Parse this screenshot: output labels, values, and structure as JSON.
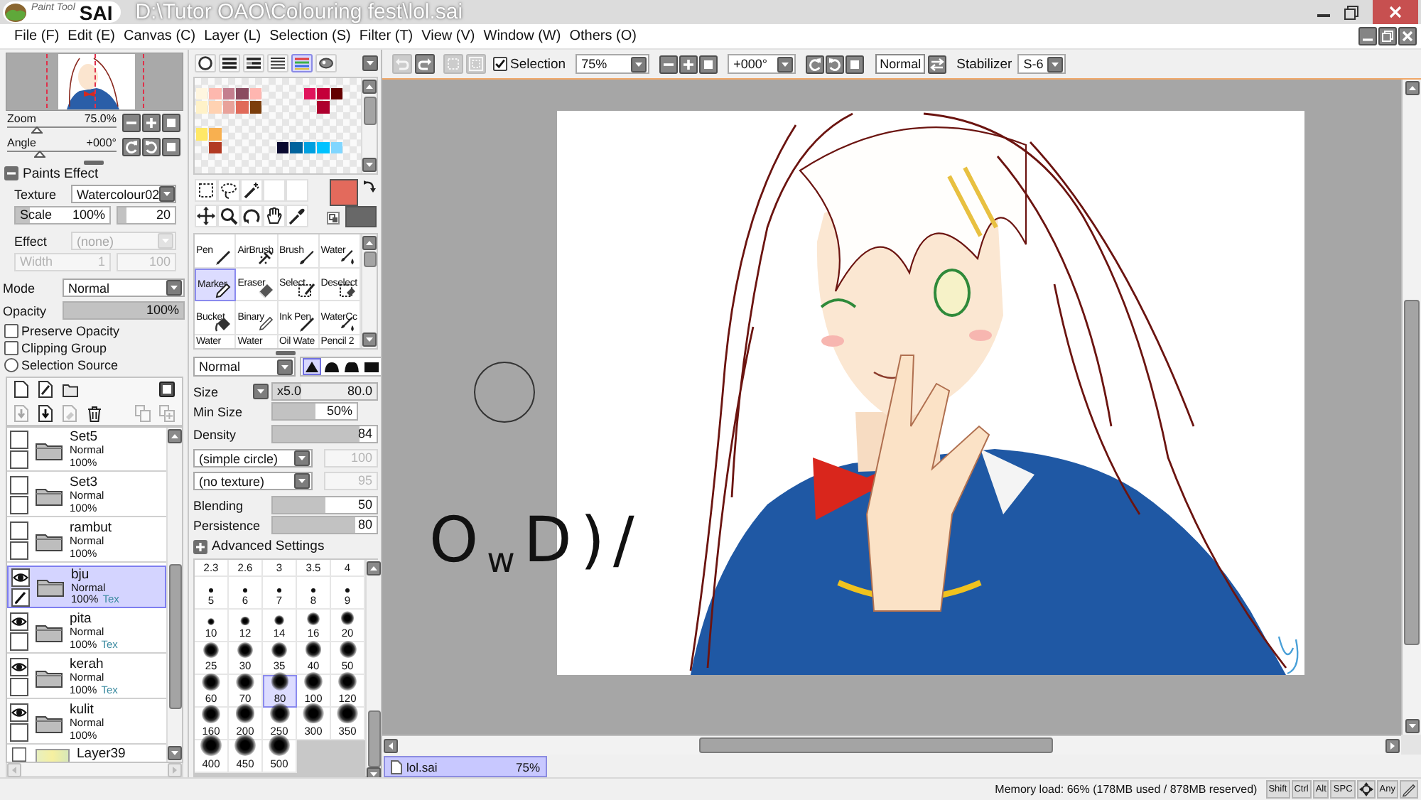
{
  "title_bar": {
    "logo": {
      "subtitle": "Paint Tool",
      "title": "SAI"
    },
    "title": "D:\\Tutor OAO\\Colouring fest\\lol.sai"
  },
  "menu": [
    "File (F)",
    "Edit (E)",
    "Canvas (C)",
    "Layer (L)",
    "Selection (S)",
    "Filter (T)",
    "View (V)",
    "Window (W)",
    "Others (O)"
  ],
  "navigator": {
    "zoom": {
      "label": "Zoom",
      "reading": "75.0%",
      "level": 0.27
    },
    "angle": {
      "label": "Angle",
      "reading": "+000°",
      "level": 0.3
    }
  },
  "paints_effect": {
    "title": "Paints Effect",
    "expanded": true,
    "texture": {
      "label": "Texture",
      "value": "Watercolour02"
    },
    "scale": {
      "label": "Scale",
      "reading": "100%",
      "level": 0.15,
      "disabled": false
    },
    "strength": {
      "reading": "20",
      "level": 0.15,
      "disabled": false
    },
    "effect": {
      "label": "Effect",
      "value": "(none)",
      "disabled": true
    },
    "width": {
      "label": "Width",
      "reading": "1",
      "disabled": true
    },
    "width_strength": {
      "reading": "100",
      "disabled": true
    }
  },
  "layer_settings": {
    "mode": {
      "label": "Mode",
      "value": "Normal"
    },
    "opacity": {
      "label": "Opacity",
      "reading": "100%",
      "level": 1
    },
    "options": [
      {
        "kind": "checkbox",
        "label": "Preserve Opacity",
        "checked": false
      },
      {
        "kind": "checkbox",
        "label": "Clipping Group",
        "checked": false
      },
      {
        "kind": "radio",
        "label": "Selection Source",
        "checked": false
      }
    ]
  },
  "layer_tools": [
    {
      "left": [
        {
          "kind": "new_layer",
          "disabled": false
        },
        {
          "kind": "new_linework",
          "disabled": false
        },
        {
          "kind": "new_folder",
          "disabled": false
        }
      ],
      "right": [
        {
          "kind": "mask",
          "disabled": false
        }
      ]
    },
    {
      "left": [
        {
          "kind": "transfer_down",
          "disabled": true
        },
        {
          "kind": "merge_down",
          "disabled": false
        },
        {
          "kind": "clear",
          "disabled": true
        },
        {
          "kind": "delete",
          "disabled": false
        }
      ],
      "right": [
        {
          "kind": "merge_visible",
          "disabled": true
        },
        {
          "kind": "merge_new",
          "disabled": true
        }
      ]
    }
  ],
  "layers": [
    {
      "kind": "folder",
      "name": "Set5",
      "mode": "Normal",
      "opacity": "100%",
      "visible": false,
      "selected": false
    },
    {
      "kind": "folder",
      "name": "Set3",
      "mode": "Normal",
      "opacity": "100%",
      "visible": false,
      "selected": false
    },
    {
      "kind": "folder",
      "name": "rambut",
      "mode": "Normal",
      "opacity": "100%",
      "visible": false,
      "selected": false
    },
    {
      "kind": "folder",
      "name": "bju",
      "mode": "Normal",
      "opacity": "100%",
      "tag": "Tex",
      "visible": true,
      "selected": true
    },
    {
      "kind": "folder",
      "name": "pita",
      "mode": "Normal",
      "opacity": "100%",
      "tag": "Tex",
      "visible": true,
      "selected": false
    },
    {
      "kind": "folder",
      "name": "kerah",
      "mode": "Normal",
      "opacity": "100%",
      "tag": "Tex",
      "visible": true,
      "selected": false
    },
    {
      "kind": "folder",
      "name": "kulit",
      "mode": "Normal",
      "opacity": "100%",
      "visible": true,
      "selected": false
    },
    {
      "kind": "layer",
      "name": "Layer39",
      "visible": false,
      "selected": false
    }
  ],
  "color_modes": [
    {
      "kind": "wheel",
      "selected": false
    },
    {
      "kind": "rgb",
      "selected": false
    },
    {
      "kind": "hsv",
      "selected": false
    },
    {
      "kind": "hsl",
      "selected": false
    },
    {
      "kind": "swatches",
      "selected": true
    },
    {
      "kind": "scratchpad",
      "selected": false
    }
  ],
  "swatch_rows": [
    [
      {
        "color": "#fff6e0"
      },
      {
        "color": "#fdb8ae"
      },
      {
        "color": "#c47e8e"
      },
      {
        "color": "#8a4b60"
      },
      {
        "color": "#ffb6b0"
      },
      null,
      null,
      null,
      {
        "color": "#e0145c"
      },
      {
        "color": "#c4003a"
      },
      {
        "color": "#640000"
      },
      null
    ],
    [
      {
        "color": "#fff2c8"
      },
      {
        "color": "#ffd2b2"
      },
      {
        "color": "#e8a29a"
      },
      {
        "color": "#e06a5a"
      },
      {
        "color": "#7c3e0c"
      },
      null,
      null,
      null,
      null,
      {
        "color": "#ae002e"
      },
      null,
      null
    ],
    [
      null,
      null,
      null,
      null,
      null,
      null,
      null,
      null,
      null,
      null,
      null,
      null
    ],
    [
      {
        "color": "#ffe866"
      },
      {
        "color": "#f8b050"
      },
      null,
      null,
      null,
      null,
      null,
      null,
      null,
      null,
      null,
      null
    ],
    [
      null,
      {
        "color": "#b23a22"
      },
      null,
      null,
      null,
      null,
      {
        "color": "#0a0a30"
      },
      {
        "color": "#00629c"
      },
      {
        "color": "#00a0e0"
      },
      {
        "color": "#00c2ff"
      },
      {
        "color": "#80d6ff"
      },
      null
    ]
  ],
  "colors": {
    "primary": {
      "color": "#e36a5c"
    },
    "secondary": {
      "color": "#686868"
    }
  },
  "brush_tools": [
    {
      "label": "Pen",
      "kind": "pen",
      "selected": false
    },
    {
      "label": "AirBrush",
      "kind": "airbrush",
      "selected": false
    },
    {
      "label": "Brush",
      "kind": "brush",
      "selected": false
    },
    {
      "label": "Water",
      "kind": "water",
      "selected": false
    },
    {
      "label": "Marker",
      "kind": "marker",
      "selected": true
    },
    {
      "label": "Eraser",
      "kind": "eraser",
      "selected": false
    },
    {
      "label": "Select",
      "kind": "select",
      "selected": false
    },
    {
      "label": "Deselect",
      "kind": "deselect",
      "selected": false
    },
    {
      "label": "Bucket",
      "kind": "bucket",
      "selected": false
    },
    {
      "label": "Binary",
      "kind": "binary",
      "selected": false
    },
    {
      "label": "Ink Pen",
      "kind": "pen",
      "selected": false
    },
    {
      "label": "WaterCc",
      "kind": "water",
      "selected": false
    },
    {
      "label": "Water",
      "kind": "none",
      "selected": false
    },
    {
      "label": "Water",
      "kind": "none",
      "selected": false
    },
    {
      "label": "Oil Wate",
      "kind": "none",
      "selected": false
    },
    {
      "label": "Pencil 2",
      "kind": "none",
      "selected": false
    }
  ],
  "brush_mode": {
    "value": "Normal"
  },
  "brush_shapes": [
    {
      "kind": "sharp",
      "selected": true
    },
    {
      "kind": "soft",
      "selected": false
    },
    {
      "kind": "flat",
      "selected": false
    },
    {
      "kind": "square",
      "selected": false
    }
  ],
  "brush_settings": {
    "size": {
      "label": "Size",
      "multiplier": "x5.0",
      "reading": "80.0",
      "level": 0.27
    },
    "min_size": {
      "label": "Min Size",
      "reading": "50%",
      "level": 0.5
    },
    "density": {
      "label": "Density",
      "reading": "84",
      "level": 0.84
    },
    "shape": {
      "value": "(simple circle)",
      "strength": {
        "reading": "100",
        "disabled": true
      }
    },
    "texture": {
      "value": "(no texture)",
      "strength": {
        "reading": "95",
        "disabled": true
      }
    },
    "blending": {
      "label": "Blending",
      "reading": "50",
      "level": 0.5
    },
    "persistence": {
      "label": "Persistence",
      "reading": "80",
      "level": 0.8
    },
    "advanced": {
      "label": "Advanced Settings",
      "expanded": false
    }
  },
  "brush_sizes": [
    {
      "label": "2.3",
      "selected": false
    },
    {
      "label": "2.6",
      "selected": false
    },
    {
      "label": "3",
      "selected": false
    },
    {
      "label": "3.5",
      "selected": false
    },
    {
      "label": "4",
      "selected": false
    },
    {
      "label": "5",
      "selected": false
    },
    {
      "label": "6",
      "selected": false
    },
    {
      "label": "7",
      "selected": false
    },
    {
      "label": "8",
      "selected": false
    },
    {
      "label": "9",
      "selected": false
    },
    {
      "label": "10",
      "selected": false
    },
    {
      "label": "12",
      "selected": false
    },
    {
      "label": "14",
      "selected": false
    },
    {
      "label": "16",
      "selected": false
    },
    {
      "label": "20",
      "selected": false
    },
    {
      "label": "25",
      "selected": false
    },
    {
      "label": "30",
      "selected": false
    },
    {
      "label": "35",
      "selected": false
    },
    {
      "label": "40",
      "selected": false
    },
    {
      "label": "50",
      "selected": false
    },
    {
      "label": "60",
      "selected": false
    },
    {
      "label": "70",
      "selected": false
    },
    {
      "label": "80",
      "selected": true
    },
    {
      "label": "100",
      "selected": false
    },
    {
      "label": "120",
      "selected": false
    },
    {
      "label": "160",
      "selected": false
    },
    {
      "label": "200",
      "selected": false
    },
    {
      "label": "250",
      "selected": false
    },
    {
      "label": "300",
      "selected": false
    },
    {
      "label": "350",
      "selected": false
    },
    {
      "label": "400",
      "selected": false
    },
    {
      "label": "450",
      "selected": false
    },
    {
      "label": "500",
      "selected": false
    }
  ],
  "canvas_toolbar": {
    "edit_buttons": [
      {
        "kind": "undo",
        "disabled": true
      },
      {
        "kind": "redo",
        "disabled": false
      },
      {
        "kind": "deselect",
        "disabled": true
      },
      {
        "kind": "invert",
        "disabled": true
      }
    ],
    "selection": {
      "label": "Selection",
      "checked": true
    },
    "zoom": "75%",
    "angle": "+000°",
    "view_mode": "Normal",
    "stabilizer": {
      "label": "Stabilizer",
      "value": "S-6"
    }
  },
  "canvas": {
    "annotation": "O$_{w}$D)/"
  },
  "documents": [
    {
      "name": "lol.sai",
      "zoom": "75%",
      "selected": true
    }
  ],
  "status_bar": {
    "memory": "Memory load: 66% (178MB used / 878MB reserved)",
    "keys": [
      {
        "kind": "key",
        "label": "Shift"
      },
      {
        "kind": "key",
        "label": "Ctrl"
      },
      {
        "kind": "key",
        "label": "Alt"
      },
      {
        "kind": "key",
        "label": "SPC"
      },
      {
        "kind": "move"
      },
      {
        "kind": "key",
        "label": "Any"
      },
      {
        "kind": "pen"
      }
    ]
  }
}
